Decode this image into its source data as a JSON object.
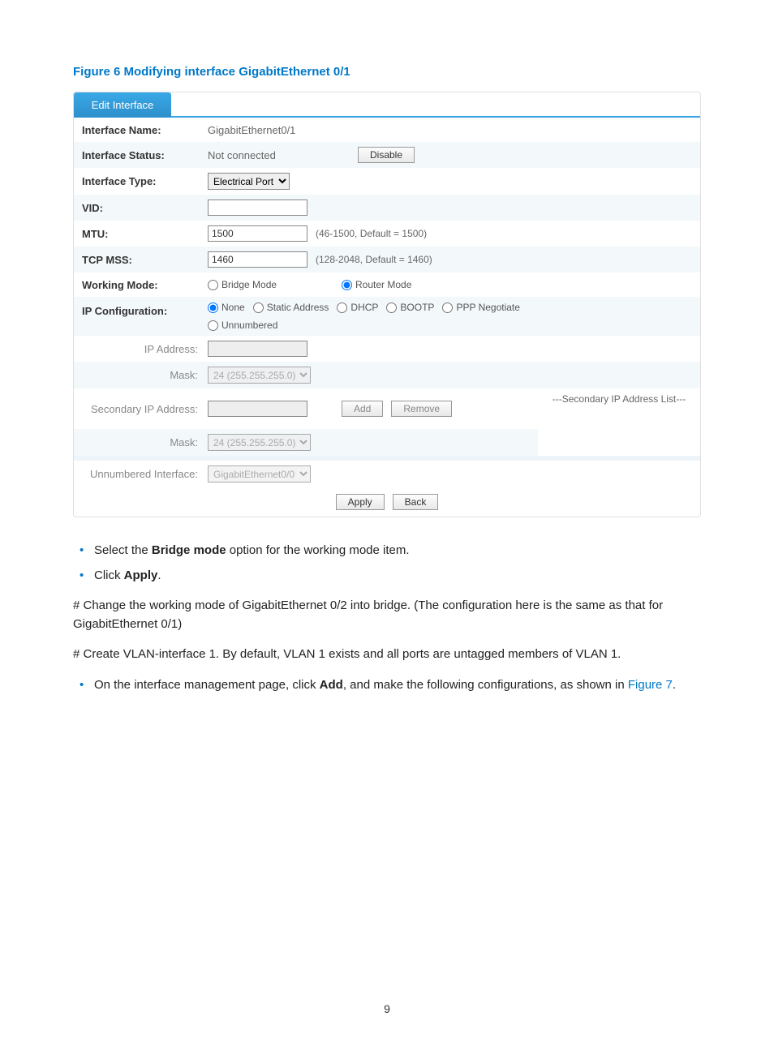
{
  "figure_caption": "Figure 6 Modifying interface GigabitEthernet 0/1",
  "tab_label": "Edit Interface",
  "rows": {
    "iface_name_label": "Interface Name:",
    "iface_name_value": "GigabitEthernet0/1",
    "iface_status_label": "Interface Status:",
    "iface_status_value": "Not connected",
    "disable_btn": "Disable",
    "iface_type_label": "Interface Type:",
    "iface_type_option": "Electrical Port",
    "vid_label": "VID:",
    "vid_value": "",
    "mtu_label": "MTU:",
    "mtu_value": "1500",
    "mtu_hint": "(46-1500, Default = 1500)",
    "tcpmss_label": "TCP MSS:",
    "tcpmss_value": "1460",
    "tcpmss_hint": "(128-2048, Default = 1460)",
    "working_mode_label": "Working Mode:",
    "wm_bridge": "Bridge Mode",
    "wm_router": "Router Mode",
    "ipcfg_label": "IP Configuration:",
    "ipcfg_none": "None",
    "ipcfg_static": "Static Address",
    "ipcfg_dhcp": "DHCP",
    "ipcfg_bootp": "BOOTP",
    "ipcfg_ppp": "PPP Negotiate",
    "ipcfg_unnum": "Unnumbered",
    "ipaddr_label": "IP Address:",
    "ipaddr_value": "",
    "mask_label": "Mask:",
    "mask_option": "24 (255.255.255.0)",
    "sec_ip_label": "Secondary IP Address:",
    "sec_ip_value": "",
    "add_btn": "Add",
    "remove_btn": "Remove",
    "sec_mask_label": "Mask:",
    "sec_list_label": "---Secondary IP Address List---",
    "unnum_label": "Unnumbered Interface:",
    "unnum_option": "GigabitEthernet0/0",
    "apply_btn": "Apply",
    "back_btn": "Back"
  },
  "body_text": {
    "bullet1_pre": "Select the ",
    "bullet1_bold": "Bridge mode",
    "bullet1_post": " option for the working mode item.",
    "bullet2_pre": "Click ",
    "bullet2_bold": "Apply",
    "bullet2_post": ".",
    "para1": "# Change the working mode of GigabitEthernet 0/2 into bridge. (The configuration here is the same as that for GigabitEthernet 0/1)",
    "para2": "# Create VLAN-interface 1. By default, VLAN 1 exists and all ports are untagged members of VLAN 1.",
    "bullet3_pre": "On the interface management page, click ",
    "bullet3_bold": "Add",
    "bullet3_post": ", and make the following configurations, as shown in ",
    "bullet3_link": "Figure 7",
    "bullet3_end": "."
  },
  "page_number": "9"
}
